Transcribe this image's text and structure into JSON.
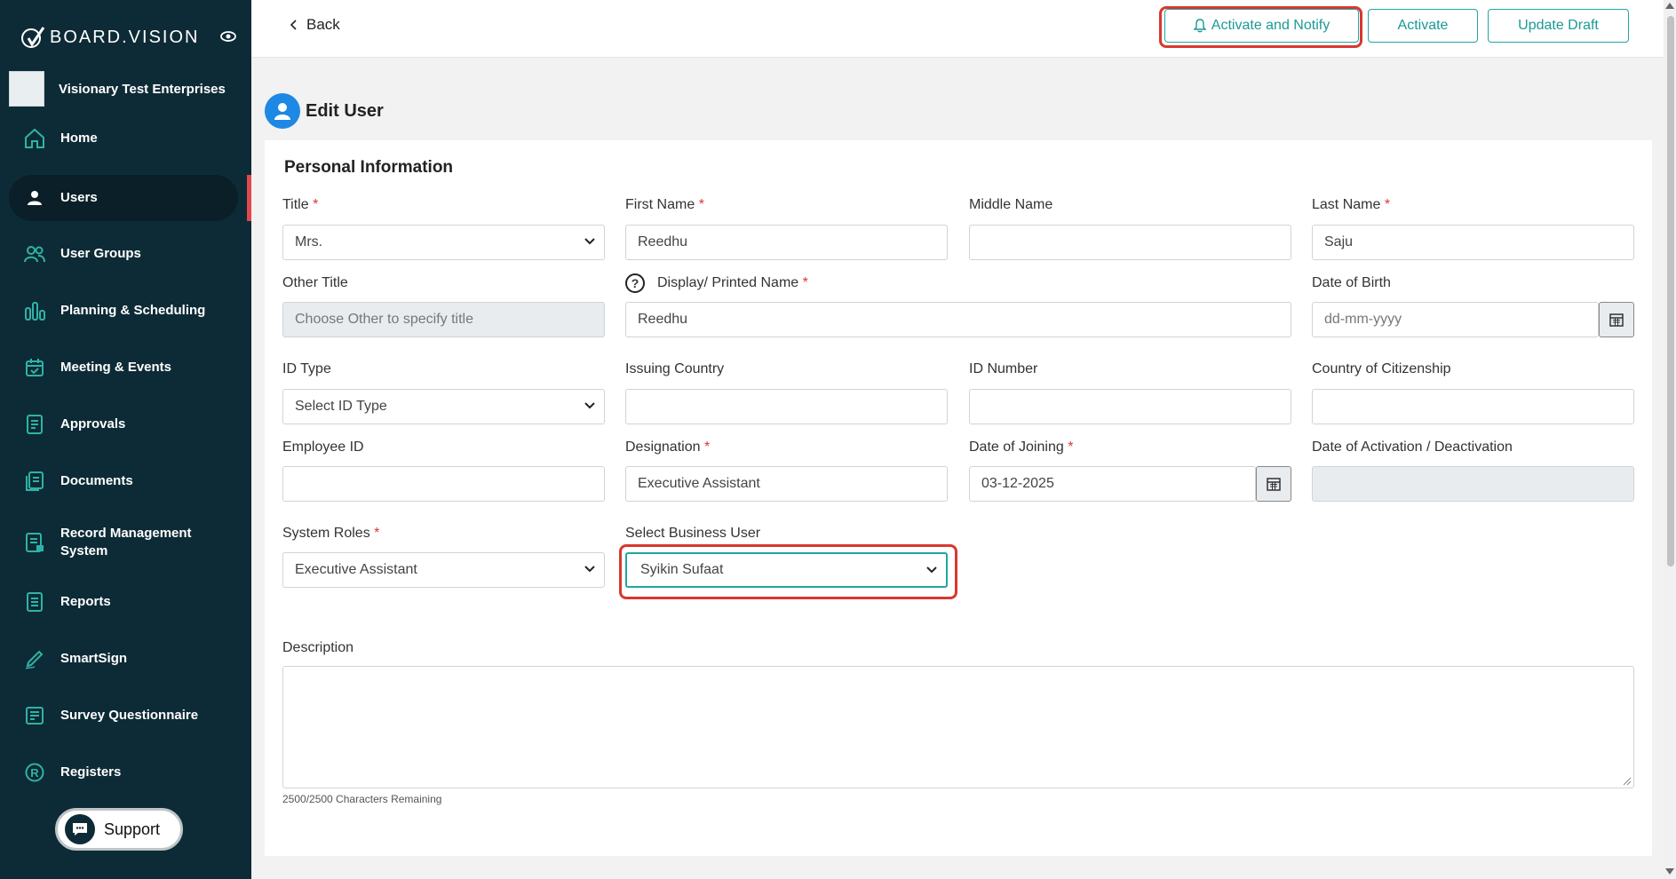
{
  "app": {
    "brand": "BOARD.VISION",
    "organization": "Visionary Test Enterprises"
  },
  "sidebar": {
    "items": [
      {
        "label": "Home",
        "icon": "home-icon"
      },
      {
        "label": "Users",
        "icon": "user-icon",
        "active": true
      },
      {
        "label": "User Groups",
        "icon": "users-icon"
      },
      {
        "label": "Planning & Scheduling",
        "icon": "chart-icon"
      },
      {
        "label": "Meeting & Events",
        "icon": "calendar-check-icon"
      },
      {
        "label": "Approvals",
        "icon": "document-icon"
      },
      {
        "label": "Documents",
        "icon": "documents-icon"
      },
      {
        "label": "Record Management System",
        "icon": "records-icon"
      },
      {
        "label": "Reports",
        "icon": "report-icon"
      },
      {
        "label": "SmartSign",
        "icon": "pen-icon"
      },
      {
        "label": "Survey Questionnaire",
        "icon": "survey-icon"
      },
      {
        "label": "Registers",
        "icon": "registered-icon"
      }
    ],
    "support_label": "Support"
  },
  "topbar": {
    "back_label": "Back",
    "activate_notify_label": "Activate and Notify",
    "activate_label": "Activate",
    "update_draft_label": "Update Draft"
  },
  "page": {
    "title": "Edit User",
    "section_title": "Personal Information"
  },
  "form": {
    "title": {
      "label": "Title",
      "value": "Mrs."
    },
    "first_name": {
      "label": "First Name",
      "value": "Reedhu"
    },
    "middle_name": {
      "label": "Middle Name",
      "value": ""
    },
    "last_name": {
      "label": "Last Name",
      "value": "Saju"
    },
    "other_title": {
      "label": "Other Title",
      "placeholder": "Choose Other to specify title"
    },
    "display_name": {
      "label": "Display/ Printed Name",
      "value": "Reedhu"
    },
    "dob": {
      "label": "Date of Birth",
      "placeholder": "dd-mm-yyyy"
    },
    "id_type": {
      "label": "ID Type",
      "value": "Select ID Type"
    },
    "issuing_country": {
      "label": "Issuing Country",
      "value": ""
    },
    "id_number": {
      "label": "ID Number",
      "value": ""
    },
    "citizenship": {
      "label": "Country of Citizenship",
      "value": ""
    },
    "employee_id": {
      "label": "Employee ID",
      "value": ""
    },
    "designation": {
      "label": "Designation",
      "value": "Executive Assistant"
    },
    "date_joining": {
      "label": "Date of Joining",
      "value": "03-12-2025"
    },
    "date_activation": {
      "label": "Date of Activation / Deactivation",
      "value": ""
    },
    "system_roles": {
      "label": "System Roles",
      "value": "Executive Assistant"
    },
    "business_user": {
      "label": "Select Business User",
      "value": "Syikin Sufaat"
    },
    "description": {
      "label": "Description",
      "hint": "2500/2500 Characters Remaining"
    }
  },
  "colors": {
    "sidebar_bg": "#0d2b36",
    "accent": "#1ea7a0",
    "highlight": "#d9382f",
    "required": "#d9382f"
  }
}
